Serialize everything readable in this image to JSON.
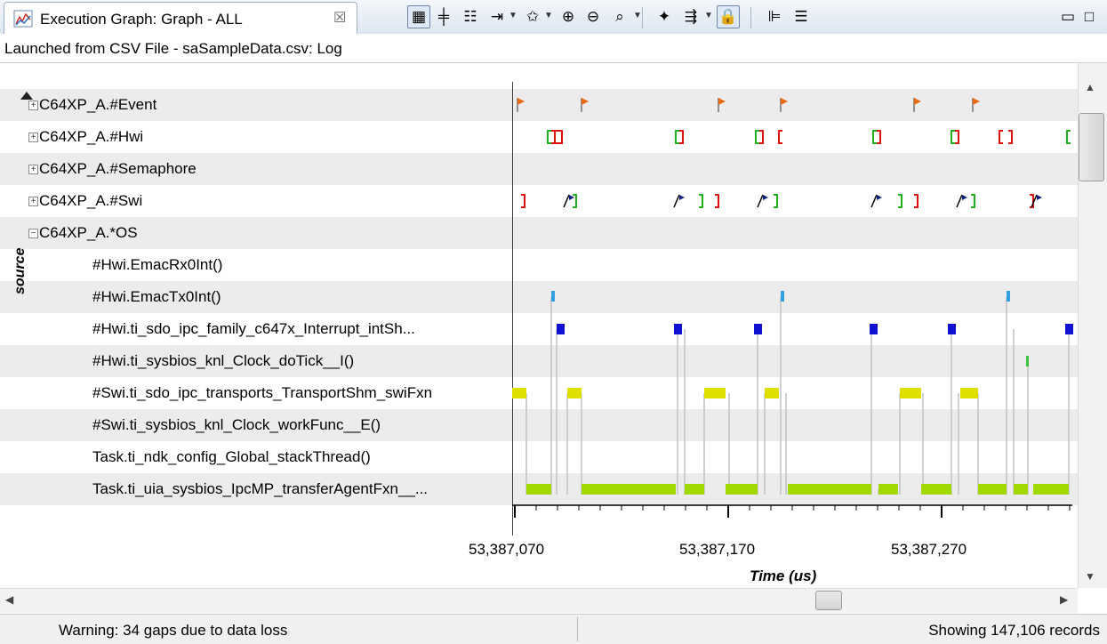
{
  "tab": {
    "title": "Execution Graph: Graph - ALL",
    "close_glyph": "☒"
  },
  "toolbar": {
    "buttons": [
      {
        "icon": "align-icon",
        "glyph": "▦",
        "pressed": true
      },
      {
        "icon": "center-align-icon",
        "glyph": "╪",
        "pressed": false
      },
      {
        "icon": "measure-icon",
        "glyph": "☷",
        "pressed": false
      },
      {
        "icon": "bookmark-icon",
        "glyph": "⇥",
        "pressed": false
      },
      {
        "icon": "star-icon",
        "glyph": "✩",
        "pressed": false
      },
      {
        "icon": "zoom-in-icon",
        "glyph": "⊕",
        "pressed": false
      },
      {
        "icon": "zoom-out-icon",
        "glyph": "⊖",
        "pressed": false
      },
      {
        "icon": "zoom-fit-icon",
        "glyph": "⌕",
        "pressed": false
      },
      {
        "icon": "find-icon",
        "glyph": "✦",
        "pressed": false
      },
      {
        "icon": "filter-icon",
        "glyph": "⇶",
        "pressed": false
      },
      {
        "icon": "lock-icon",
        "glyph": "🔒",
        "pressed": true
      },
      {
        "icon": "tree-icon",
        "glyph": "⊫",
        "pressed": false
      },
      {
        "icon": "list-icon",
        "glyph": "☰",
        "pressed": false
      },
      {
        "icon": "minimize-icon",
        "glyph": "▭",
        "pressed": false
      },
      {
        "icon": "maximize-icon",
        "glyph": "□",
        "pressed": false
      }
    ]
  },
  "launched_text": "Launched from CSV File - saSampleData.csv: Log",
  "source_label": "source",
  "rows": [
    {
      "label": "C64XP_A.#Event",
      "level": 0,
      "expander": "+"
    },
    {
      "label": "C64XP_A.#Hwi",
      "level": 0,
      "expander": "+"
    },
    {
      "label": "C64XP_A.#Semaphore",
      "level": 0,
      "expander": "+"
    },
    {
      "label": "C64XP_A.#Swi",
      "level": 0,
      "expander": "+"
    },
    {
      "label": "C64XP_A.*OS",
      "level": 0,
      "expander": "−"
    },
    {
      "label": "#Hwi.EmacRx0Int()",
      "level": 1
    },
    {
      "label": "#Hwi.EmacTx0Int()",
      "level": 1
    },
    {
      "label": "#Hwi.ti_sdo_ipc_family_c647x_Interrupt_intSh...",
      "level": 1
    },
    {
      "label": "#Hwi.ti_sysbios_knl_Clock_doTick__I()",
      "level": 1
    },
    {
      "label": "#Swi.ti_sdo_ipc_transports_TransportShm_swiFxn",
      "level": 1
    },
    {
      "label": "#Swi.ti_sysbios_knl_Clock_workFunc__E()",
      "level": 1
    },
    {
      "label": "Task.ti_ndk_config_Global_stackThread()",
      "level": 1
    },
    {
      "label": "Task.ti_uia_sysbios_IpcMP_transferAgentFxn__...",
      "level": 1
    }
  ],
  "axis": {
    "ticks": [
      "53,387,070",
      "53,387,170",
      "53,387,270"
    ],
    "title": "Time  (us)"
  },
  "colors": {
    "event_flag": "#e86a10",
    "hwi_bracket_red": "#e01010",
    "hwi_bracket_green": "#20b020",
    "swi_flag": "#102080",
    "hwi_blue": "#1010d0",
    "hwi_cyan": "#30a0e0",
    "swi_yellow": "#e0e000",
    "task_green": "#a0d800",
    "clock_green": "#40c040",
    "trace_gray": "#c0c0c0"
  },
  "status": {
    "warning": "Warning: 34 gaps due to data loss",
    "records": "Showing 147,106 records"
  }
}
